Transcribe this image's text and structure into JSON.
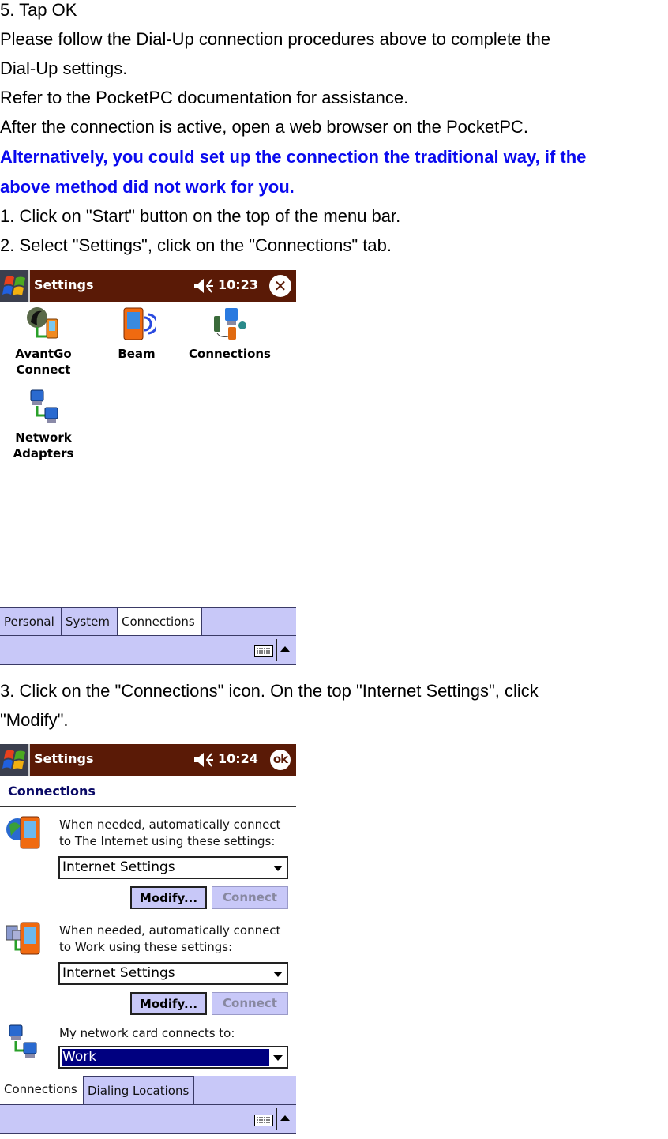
{
  "document": {
    "paragraphs_top": [
      {
        "text": "5. Tap OK",
        "style": "normal"
      },
      {
        "text": "Please follow the Dial-Up connection procedures above to complete the",
        "style": "normal"
      },
      {
        "text": "Dial-Up settings.",
        "style": "normal"
      },
      {
        "text": "Refer to the PocketPC documentation for assistance.",
        "style": "normal"
      },
      {
        "text": "After the connection is active, open a web browser on the PocketPC.",
        "style": "normal"
      },
      {
        "text": "Alternatively, you could set up the connection the traditional way, if the",
        "style": "emphasis"
      },
      {
        "text": "above method did not work for you.",
        "style": "emphasis"
      },
      {
        "text": "1. Click on \"Start\" button on the top of the menu bar.",
        "style": "normal"
      },
      {
        "text": "2. Select \"Settings\", click on the \"Connections\" tab.",
        "style": "normal"
      }
    ],
    "paragraphs_middle": [
      {
        "text": "3. Click on the \"Connections\" icon. On the top \"Internet Settings\", click"
      },
      {
        "text": "\"Modify\"."
      }
    ],
    "emphasis_color": "#0a0aee"
  },
  "screenshot1": {
    "titlebar": {
      "title": "Settings",
      "time": "10:23",
      "close_glyph": "✕",
      "color": "#5a1a06"
    },
    "icons": [
      {
        "label_line1": "AvantGo",
        "label_line2": "Connect",
        "icon": "avantgo-icon"
      },
      {
        "label_line1": "Beam",
        "label_line2": "",
        "icon": "beam-icon"
      },
      {
        "label_line1": "Connections",
        "label_line2": "",
        "icon": "connections-icon"
      },
      {
        "label_line1": "Network",
        "label_line2": "Adapters",
        "icon": "network-adapters-icon"
      }
    ],
    "tabs": [
      {
        "label": "Personal",
        "active": false
      },
      {
        "label": "System",
        "active": false
      },
      {
        "label": "Connections",
        "active": true
      }
    ],
    "tab_color": "#c8c8f8"
  },
  "screenshot2": {
    "titlebar": {
      "title": "Settings",
      "time": "10:24",
      "ok_label": "ok"
    },
    "section_title": "Connections",
    "groups": [
      {
        "desc_line1": "When needed, automatically connect",
        "desc_line2": "to The Internet using these settings:",
        "combo_value": "Internet Settings",
        "modify_label": "Modify...",
        "connect_label": "Connect"
      },
      {
        "desc_line1": "When needed, automatically connect",
        "desc_line2": "to Work using these settings:",
        "combo_value": "Internet Settings",
        "modify_label": "Modify...",
        "connect_label": "Connect"
      }
    ],
    "network_card": {
      "label": "My network card connects to:",
      "combo_value": "Work"
    },
    "tabs": [
      {
        "label": "Connections",
        "active": true
      },
      {
        "label": "Dialing Locations",
        "active": false
      }
    ]
  }
}
